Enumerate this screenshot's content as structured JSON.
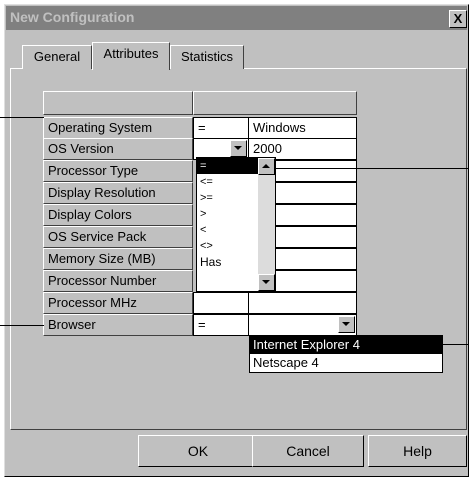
{
  "window": {
    "title": "New Configuration",
    "close_glyph": "X"
  },
  "tabs": [
    {
      "label": "General",
      "active": false
    },
    {
      "label": "Attributes",
      "active": true
    },
    {
      "label": "Statistics",
      "active": false
    }
  ],
  "grid": {
    "rows": [
      {
        "label": "Operating System",
        "operator": "=",
        "value": "Windows"
      },
      {
        "label": "OS Version",
        "operator": "",
        "value": "2000"
      },
      {
        "label": "Processor Type",
        "operator": "",
        "value": ""
      },
      {
        "label": "Display Resolution",
        "operator": "",
        "value": ""
      },
      {
        "label": "Display Colors",
        "operator": "",
        "value": ""
      },
      {
        "label": "OS Service Pack",
        "operator": "",
        "value": ""
      },
      {
        "label": "Memory Size (MB)",
        "operator": "",
        "value": ""
      },
      {
        "label": "Processor Number",
        "operator": "",
        "value": ""
      },
      {
        "label": "Processor MHz",
        "operator": "",
        "value": ""
      },
      {
        "label": "Browser",
        "operator": "=",
        "value": ""
      }
    ]
  },
  "operator_dropdown": {
    "options": [
      "=",
      "<=",
      ">=",
      ">",
      "<",
      "<>",
      "Has"
    ],
    "selected": "="
  },
  "browser_dropdown": {
    "options": [
      "Internet Explorer 4",
      "Netscape 4"
    ],
    "selected": "Internet Explorer 4"
  },
  "buttons": {
    "ok": "OK",
    "cancel": "Cancel",
    "help": "Help"
  }
}
